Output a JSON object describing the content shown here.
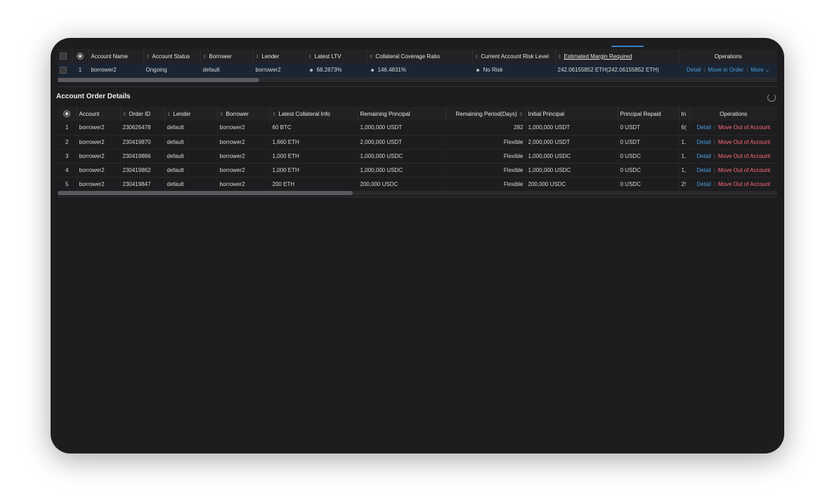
{
  "account_table": {
    "headers": {
      "account_name": "Account Name",
      "account_status": "Account Status",
      "borrower": "Borrower",
      "lender": "Lender",
      "latest_ltv": "Latest LTV",
      "collateral_coverage_ratio": "Collateral Coverage Ratio",
      "current_account_risk_level": "Current Account Risk Level",
      "estimated_margin_required": "Estimated Margin Required",
      "operations": "Operations"
    },
    "row": {
      "index": "1",
      "account_name": "borrower2",
      "account_status": "Ongoing",
      "borrower": "default",
      "lender": "borrower2",
      "latest_ltv": "68.2673%",
      "collateral_coverage_ratio": "146.4831%",
      "risk_level": "No Risk",
      "estimated_margin": "242.06155852 ETH(242.06155852 ETH)",
      "op_detail": "Detail",
      "op_move_in_order": "Move in Order",
      "op_more": "More"
    },
    "scroll_fraction": 0.28
  },
  "order_details": {
    "title": "Account Order Details",
    "headers": {
      "account": "Account",
      "order_id": "Order ID",
      "lender": "Lender",
      "borrower": "Borrower",
      "latest_collateral_info": "Latest Collateral Info",
      "remaining_principal": "Remaining Principal",
      "remaining_period": "Remaining Period(Days)",
      "initial_principal": "Initial Principal",
      "principal_repaid": "Principal Repaid",
      "truncated_col": "In",
      "operations": "Operations"
    },
    "rows": [
      {
        "index": "1",
        "account": "borrower2",
        "order_id": "230626478",
        "lender": "default",
        "borrower": "borrower2",
        "collateral": "60 BTC",
        "remaining_principal": "1,000,000 USDT",
        "remaining_period": "282",
        "initial_principal": "1,000,000 USDT",
        "principal_repaid": "0 USDT",
        "truncated": "6(",
        "op_detail": "Detail",
        "op_move_out": "Move Out of Account"
      },
      {
        "index": "2",
        "account": "borrower2",
        "order_id": "230419870",
        "lender": "default",
        "borrower": "borrower2",
        "collateral": "1,660 ETH",
        "remaining_principal": "2,000,000 USDT",
        "remaining_period": "Flexible",
        "initial_principal": "2,000,000 USDT",
        "principal_repaid": "0 USDT",
        "truncated": "1,",
        "op_detail": "Detail",
        "op_move_out": "Move Out of Account"
      },
      {
        "index": "3",
        "account": "borrower2",
        "order_id": "230419866",
        "lender": "default",
        "borrower": "borrower2",
        "collateral": "1,000 ETH",
        "remaining_principal": "1,000,000 USDC",
        "remaining_period": "Flexible",
        "initial_principal": "1,000,000 USDC",
        "principal_repaid": "0 USDC",
        "truncated": "1,",
        "op_detail": "Detail",
        "op_move_out": "Move Out of Account"
      },
      {
        "index": "4",
        "account": "borrower2",
        "order_id": "230419862",
        "lender": "default",
        "borrower": "borrower2",
        "collateral": "1,000 ETH",
        "remaining_principal": "1,000,000 USDC",
        "remaining_period": "Flexible",
        "initial_principal": "1,000,000 USDC",
        "principal_repaid": "0 USDC",
        "truncated": "1,",
        "op_detail": "Detail",
        "op_move_out": "Move Out of Account"
      },
      {
        "index": "5",
        "account": "borrower2",
        "order_id": "230419847",
        "lender": "default",
        "borrower": "borrower2",
        "collateral": "200 ETH",
        "remaining_principal": "200,000 USDC",
        "remaining_period": "Flexible",
        "initial_principal": "200,000 USDC",
        "principal_repaid": "0 USDC",
        "truncated": "2!",
        "op_detail": "Detail",
        "op_move_out": "Move Out of Account"
      }
    ],
    "scroll_fraction": 0.41
  },
  "icons": {
    "sort": "sort-icon",
    "refresh": "refresh-icon",
    "chevron": "chevron-down-icon"
  },
  "colors": {
    "link": "#4a9de0",
    "danger": "#ff6b7a",
    "selected_row": "#1a2533"
  }
}
